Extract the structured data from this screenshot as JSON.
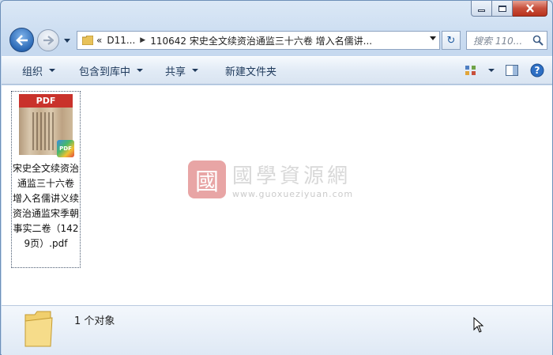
{
  "window": {
    "caption": {
      "minimize": "minimize",
      "maximize": "maximize",
      "close": "close"
    }
  },
  "nav": {
    "address_root": "«",
    "breadcrumbs": [
      "D11...",
      "110642 宋史全文续资治通监三十六卷 增入名儒讲..."
    ],
    "search_placeholder": "搜索 110..."
  },
  "toolbar": {
    "organize": "组织",
    "include_in_library": "包含到库中",
    "share": "共享",
    "new_folder": "新建文件夹"
  },
  "files": [
    {
      "name": "宋史全文续资治通监三十六卷 增入名儒讲义续资治通监宋季朝事实二卷（1429页）.pdf",
      "thumb_label": "PDF",
      "badge": "PDF"
    }
  ],
  "watermark": {
    "logo_char": "國",
    "title": "國學資源網",
    "url": "www.guoxueziyuan.com"
  },
  "status": {
    "count_text": "1 个对象"
  },
  "colors": {
    "accent": "#2b69b6",
    "pdf_red": "#c9322b",
    "close_red": "#c8503c"
  }
}
